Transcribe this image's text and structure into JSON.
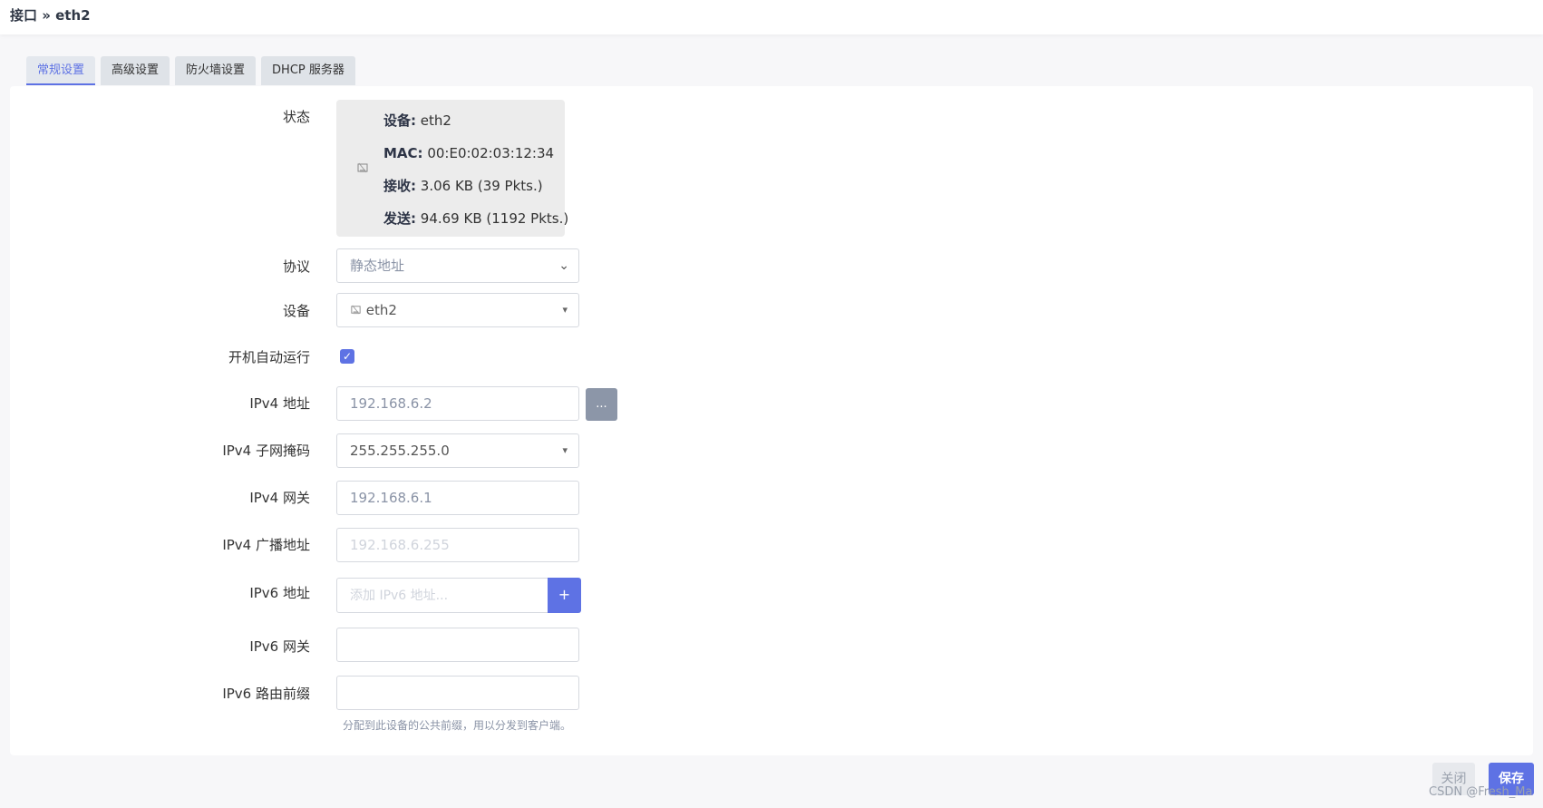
{
  "breadcrumb": "接口 » eth2",
  "tabs": [
    {
      "label": "常规设置",
      "active": true
    },
    {
      "label": "高级设置",
      "active": false
    },
    {
      "label": "防火墙设置",
      "active": false
    },
    {
      "label": "DHCP 服务器",
      "active": false
    }
  ],
  "status": {
    "label": "状态",
    "device_key": "设备:",
    "device_val": "eth2",
    "mac_key": "MAC:",
    "mac_val": "00:E0:02:03:12:34",
    "rx_key": "接收:",
    "rx_val": "3.06 KB (39 Pkts.)",
    "tx_key": "发送:",
    "tx_val": "94.69 KB (1192 Pkts.)"
  },
  "fields": {
    "protocol_label": "协议",
    "protocol_value": "静态地址",
    "device_label": "设备",
    "device_value": "eth2",
    "autostart_label": "开机自动运行",
    "autostart_checked": true,
    "ipv4_addr_label": "IPv4 地址",
    "ipv4_addr_value": "192.168.6.2",
    "ipv4_addr_button": "...",
    "ipv4_mask_label": "IPv4 子网掩码",
    "ipv4_mask_value": "255.255.255.0",
    "ipv4_gw_label": "IPv4 网关",
    "ipv4_gw_value": "192.168.6.1",
    "ipv4_bcast_label": "IPv4 广播地址",
    "ipv4_bcast_placeholder": "192.168.6.255",
    "ipv6_addr_label": "IPv6 地址",
    "ipv6_addr_placeholder": "添加 IPv6 地址...",
    "ipv6_addr_button": "+",
    "ipv6_gw_label": "IPv6 网关",
    "ipv6_gw_value": "",
    "ipv6_prefix_label": "IPv6 路由前缀",
    "ipv6_prefix_value": "",
    "ipv6_prefix_hint": "分配到此设备的公共前缀，用以分发到客户端。"
  },
  "footer": {
    "close_label": "关闭",
    "save_label": "保存"
  },
  "watermark": "CSDN @Fresh_Ma",
  "colors": {
    "accent": "#5e72e4",
    "secondary_button": "#8c96a8"
  }
}
